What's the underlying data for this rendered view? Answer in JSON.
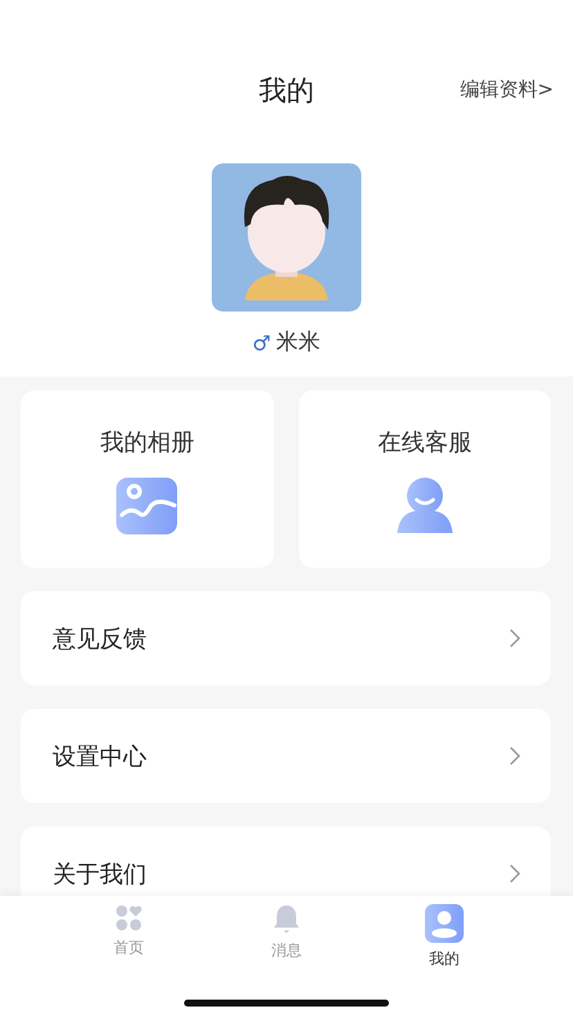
{
  "header": {
    "title": "我的",
    "edit_link": "编辑资料>"
  },
  "profile": {
    "gender_symbol": "♂",
    "name": "米米"
  },
  "cards": [
    {
      "kind": "album",
      "label": "我的相册"
    },
    {
      "kind": "service",
      "label": "在线客服"
    }
  ],
  "menu": [
    {
      "label": "意见反馈"
    },
    {
      "label": "设置中心"
    },
    {
      "label": "关于我们"
    }
  ],
  "tab_bar": [
    {
      "kind": "home",
      "label": "首页",
      "selected": false
    },
    {
      "kind": "messages",
      "label": "消息",
      "selected": false
    },
    {
      "kind": "me",
      "label": "我的",
      "selected": true
    }
  ]
}
